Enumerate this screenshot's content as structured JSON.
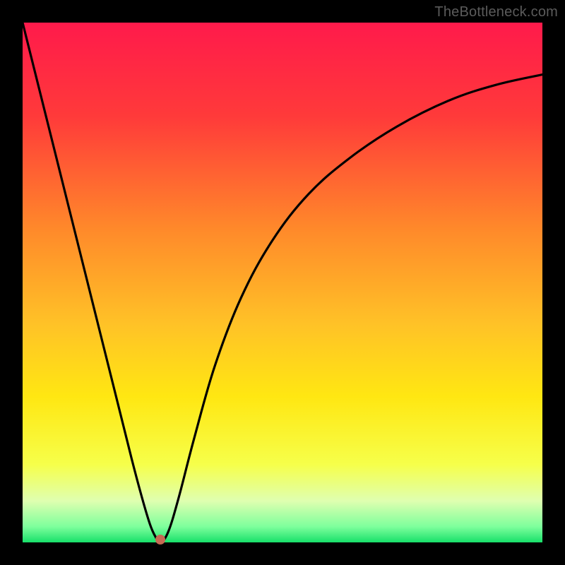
{
  "watermark": "TheBottleneck.com",
  "colors": {
    "frame": "#000000",
    "gradient_stops": [
      {
        "pct": 0,
        "color": "#ff1a4b"
      },
      {
        "pct": 18,
        "color": "#ff3a3a"
      },
      {
        "pct": 40,
        "color": "#ff8a2a"
      },
      {
        "pct": 58,
        "color": "#ffc227"
      },
      {
        "pct": 72,
        "color": "#ffe712"
      },
      {
        "pct": 85,
        "color": "#f6ff4a"
      },
      {
        "pct": 92,
        "color": "#dfffb0"
      },
      {
        "pct": 97,
        "color": "#7dff9c"
      },
      {
        "pct": 100,
        "color": "#18e06a"
      }
    ],
    "curve": "#000000",
    "marker": "#c56a53"
  },
  "marker": {
    "x_frac": 0.265,
    "y_frac": 0.995
  },
  "chart_data": {
    "type": "line",
    "title": "",
    "xlabel": "",
    "ylabel": "",
    "xlim": [
      0,
      1
    ],
    "ylim": [
      0,
      1
    ],
    "series": [
      {
        "name": "bottleneck-curve",
        "x": [
          0.0,
          0.03,
          0.06,
          0.09,
          0.12,
          0.15,
          0.18,
          0.21,
          0.23,
          0.245,
          0.255,
          0.265,
          0.28,
          0.3,
          0.33,
          0.37,
          0.42,
          0.48,
          0.55,
          0.63,
          0.72,
          0.82,
          0.91,
          1.0
        ],
        "y": [
          1.0,
          0.88,
          0.76,
          0.64,
          0.52,
          0.4,
          0.28,
          0.16,
          0.085,
          0.035,
          0.012,
          0.0,
          0.02,
          0.085,
          0.2,
          0.34,
          0.47,
          0.58,
          0.67,
          0.74,
          0.8,
          0.85,
          0.88,
          0.9
        ]
      }
    ],
    "annotations": []
  }
}
